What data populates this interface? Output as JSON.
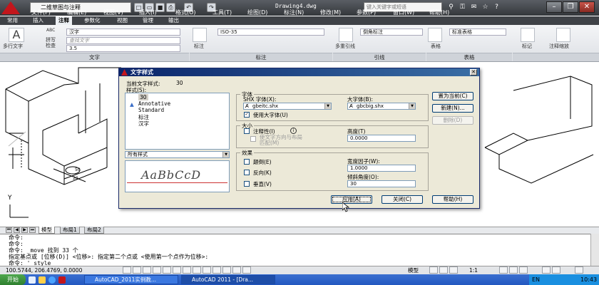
{
  "window": {
    "workspace": "二维草图与注释",
    "title": "Drawing4.dwg",
    "search_placeholder": "键入关键字或短语"
  },
  "menu": [
    "文件(F)",
    "编辑(E)",
    "视图(V)",
    "插入(I)",
    "格式(O)",
    "工具(T)",
    "绘图(D)",
    "标注(N)",
    "修改(M)",
    "参数(P)",
    "窗口(W)",
    "帮助(H)"
  ],
  "ribbon_tabs": [
    "常用",
    "插入",
    "注释",
    "参数化",
    "视图",
    "管理",
    "输出"
  ],
  "ribbon": {
    "multiline_text": "多行文字",
    "spell_check": "拼写\n检查",
    "abc": "ABC",
    "text_style_combo": "汉字",
    "find_text": "查找文字",
    "text_height": "3.5",
    "dim_label": "标注",
    "dim_style": "ISO-35",
    "multileader_label": "多重引线",
    "mleader_style": "倒角标注",
    "table_label": "表格",
    "table_style": "标准表格",
    "mark_label": "标记",
    "anno_scale": "注释缩放",
    "panel_text": "文字",
    "panel_dim": "标注",
    "panel_leader": "引线",
    "panel_table": "表格"
  },
  "drawing": {
    "dim_20": "20",
    "dim_50": "50",
    "axis_y": "Y"
  },
  "layout_tabs": [
    "模型",
    "布局1",
    "布局2"
  ],
  "command": {
    "lines": [
      "命令:",
      "命令:",
      "命令:  _move 找到 33 个",
      "指定基点或 [位移(D)] <位移>:  指定第二个点或 <使用第一个点作为位移>:",
      "命令: '_style"
    ]
  },
  "statusbar": {
    "coords": "100.5744, 206.4769, 0.0000",
    "model": "模型",
    "scale": "1:1"
  },
  "taskbar": {
    "start": "开始",
    "tasks": [
      "AutoCAD_2011实例教...",
      "AutoCAD 2011 - [Dra..."
    ],
    "lang": "EN",
    "time": "10:43"
  },
  "dialog": {
    "title": "文字样式",
    "current_style_label": "当前文字样式:",
    "current_style_value": "30",
    "styles_label": "样式(S):",
    "styles": [
      "30",
      "Annotative",
      "Standard",
      "标注",
      "汉字"
    ],
    "filter": "所有样式",
    "preview_text": "AaBbCcD",
    "font_group": "字体",
    "shx_font_label": "SHX 字体(X):",
    "shx_font": "gbeitc.shx",
    "big_font_label": "大字体(B):",
    "big_font": "gbcbig.shx",
    "use_big_font": "使用大字体(U)",
    "size_group": "大小",
    "annotative": "注释性(I)",
    "match_orientation": "使文字方向与布局\n匹配(M)",
    "height_label": "高度(T)",
    "height_value": "0.0000",
    "effects_group": "效果",
    "upside_down": "颠倒(E)",
    "backwards": "反向(K)",
    "vertical": "垂直(V)",
    "width_factor_label": "宽度因子(W):",
    "width_factor": "1.0000",
    "oblique_label": "倾斜角度(O):",
    "oblique": "30",
    "set_current": "置为当前(C)",
    "new": "新建(N)...",
    "delete": "删除(D)",
    "apply": "应用(A)",
    "close": "关闭(C)",
    "help": "帮助(H)"
  }
}
